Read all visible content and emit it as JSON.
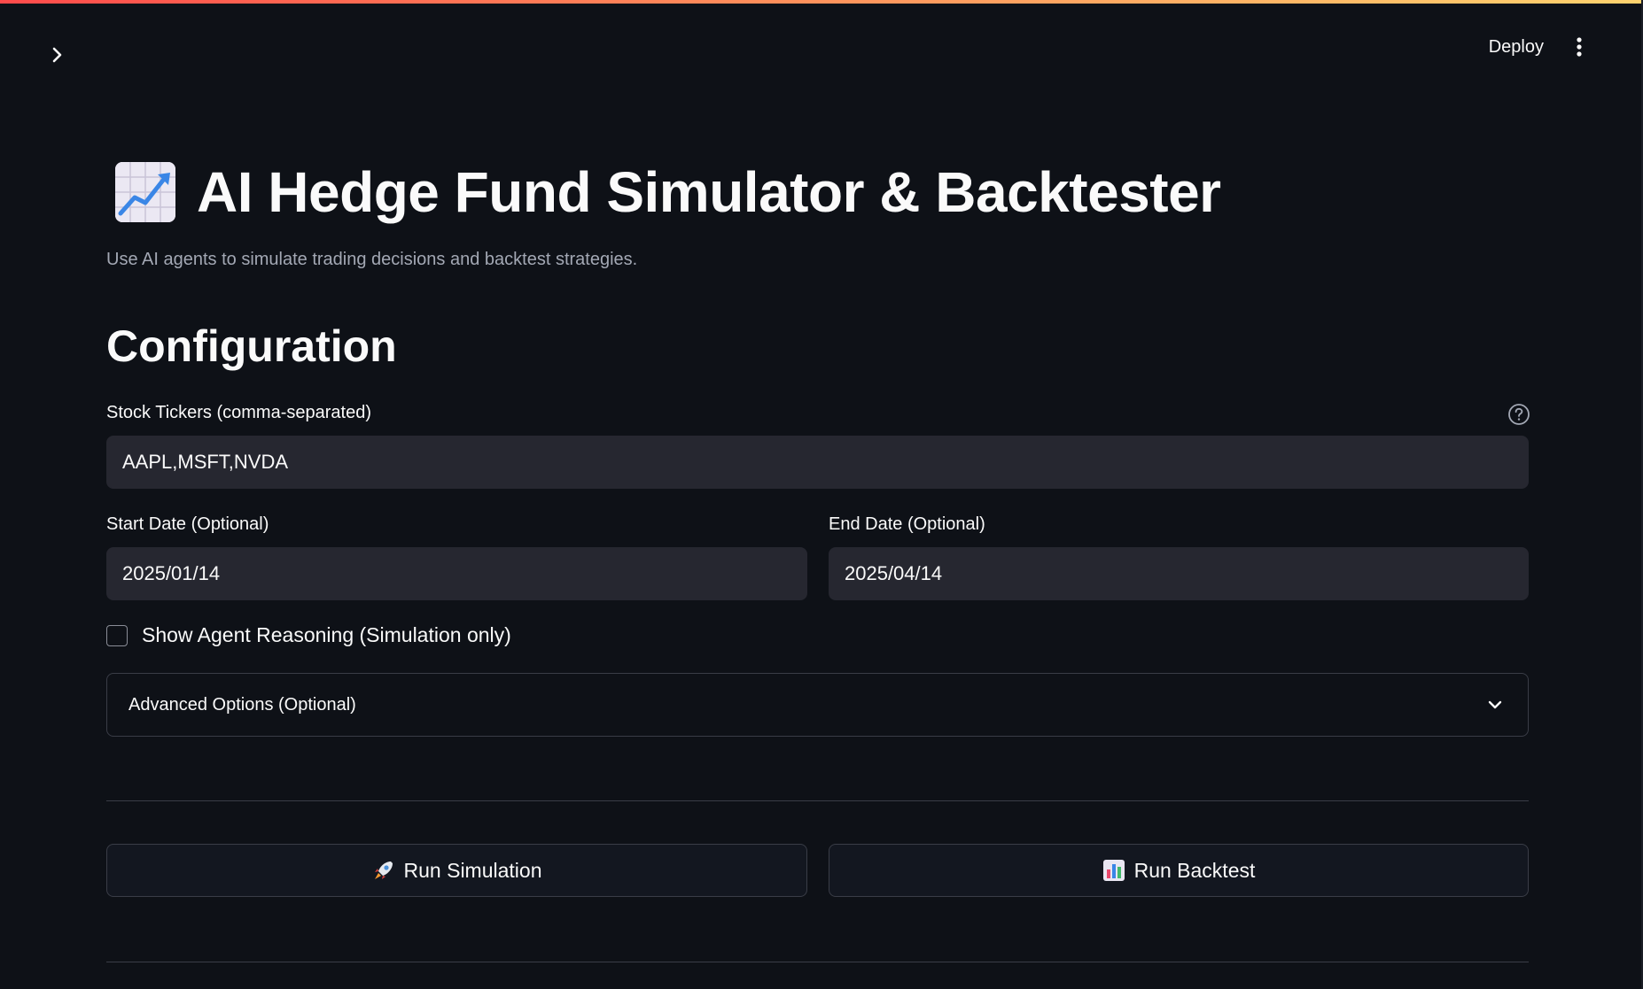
{
  "header": {
    "deploy_label": "Deploy"
  },
  "icons": {
    "sidebar_toggle": "chevron-right-icon",
    "main_menu": "kebab-menu-icon",
    "title": "chart-increasing-emoji",
    "help": "question-circle-icon",
    "expander": "chevron-down-icon",
    "simulation": "rocket-emoji",
    "backtest": "bar-chart-emoji"
  },
  "page": {
    "title": "AI Hedge Fund Simulator & Backtester",
    "subtitle": "Use AI agents to simulate trading decisions and backtest strategies.",
    "section_heading": "Configuration"
  },
  "form": {
    "tickers": {
      "label": "Stock Tickers (comma-separated)",
      "value": "AAPL,MSFT,NVDA"
    },
    "start_date": {
      "label": "Start Date (Optional)",
      "value": "2025/01/14"
    },
    "end_date": {
      "label": "End Date (Optional)",
      "value": "2025/04/14"
    },
    "show_reasoning": {
      "label": "Show Agent Reasoning (Simulation only)",
      "checked": false
    },
    "advanced": {
      "label": "Advanced Options (Optional)"
    }
  },
  "actions": {
    "run_simulation": "Run Simulation",
    "run_backtest": "Run Backtest"
  },
  "colors": {
    "background": "#0e1117",
    "input_background": "#262730",
    "border": "#3a3d47",
    "accent_gradient_start": "#ff4b4b",
    "accent_gradient_end": "#ffd36e",
    "muted_text": "#a3a8b4"
  }
}
